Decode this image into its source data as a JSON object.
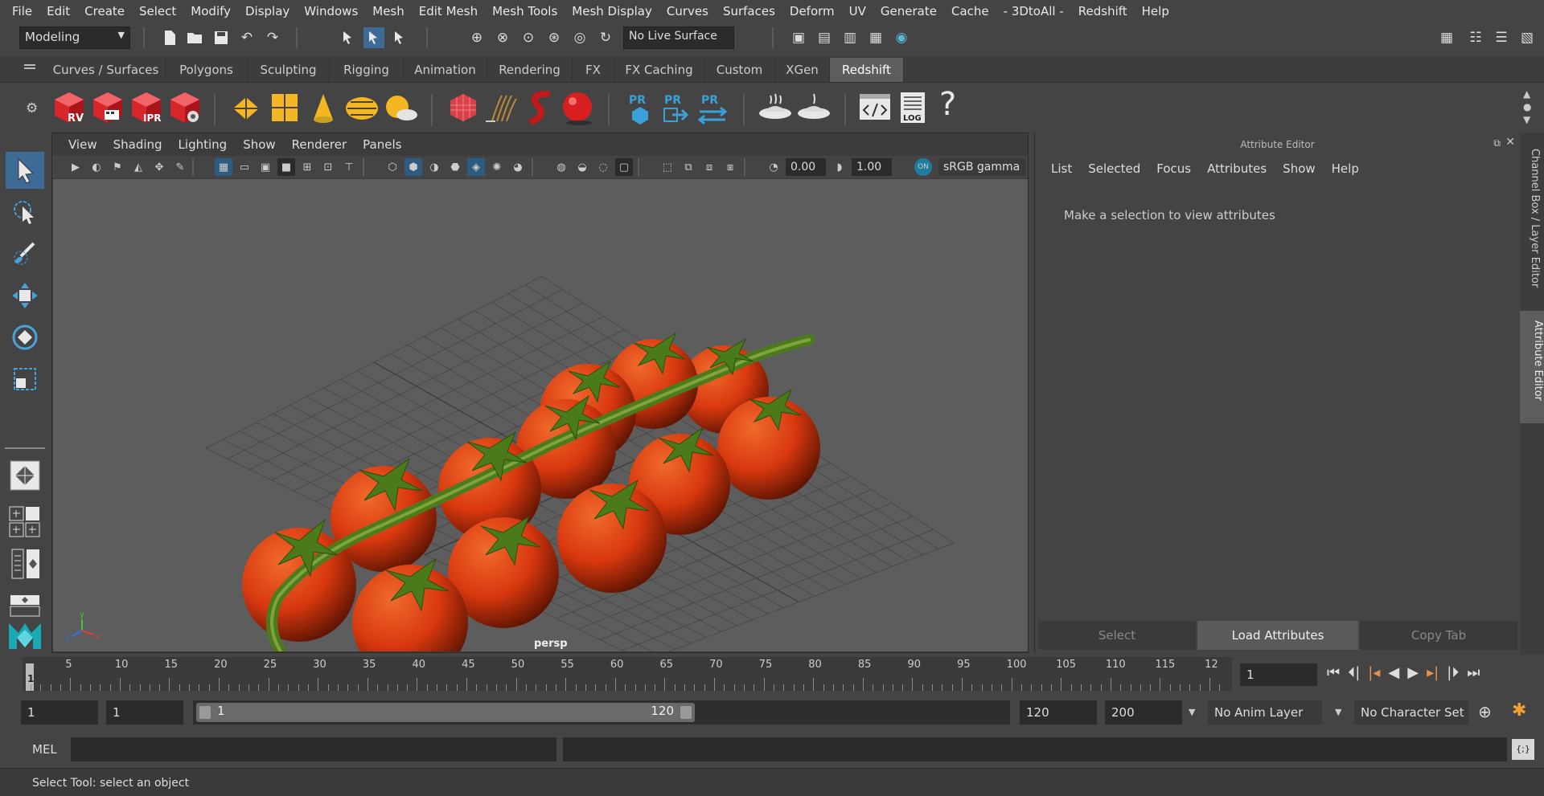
{
  "menubar": {
    "items": [
      "File",
      "Edit",
      "Create",
      "Select",
      "Modify",
      "Display",
      "Windows",
      "Mesh",
      "Edit Mesh",
      "Mesh Tools",
      "Mesh Display",
      "Curves",
      "Surfaces",
      "Deform",
      "UV",
      "Generate",
      "Cache",
      "- 3DtoAll -",
      "Redshift",
      "Help"
    ]
  },
  "statusline": {
    "workspace": "Modeling",
    "live_surface": "No Live Surface"
  },
  "shelf": {
    "tabs": [
      "Curves / Surfaces",
      "Polygons",
      "Sculpting",
      "Rigging",
      "Animation",
      "Rendering",
      "FX",
      "FX Caching",
      "Custom",
      "XGen",
      "Redshift"
    ],
    "active_tab": "Redshift",
    "icon_labels": {
      "rv": "RV",
      "ipr": "IPR",
      "pr": "PR",
      "log": "LOG",
      "help": "?"
    }
  },
  "viewport": {
    "menu": [
      "View",
      "Shading",
      "Lighting",
      "Show",
      "Renderer",
      "Panels"
    ],
    "exposure": "0.00",
    "gamma": "1.00",
    "color_space": "sRGB gamma",
    "camera_label": "persp",
    "axis_labels": {
      "x": "x",
      "y": "y",
      "z": "z"
    }
  },
  "attribute_editor": {
    "title": "Attribute Editor",
    "menu": [
      "List",
      "Selected",
      "Focus",
      "Attributes",
      "Show",
      "Help"
    ],
    "message": "Make a selection to view attributes",
    "buttons": [
      "Select",
      "Load Attributes",
      "Copy Tab"
    ]
  },
  "side_tabs": [
    "Channel Box / Layer Editor",
    "Attribute Editor"
  ],
  "timeslider": {
    "ticks": [
      "5",
      "10",
      "15",
      "20",
      "25",
      "30",
      "35",
      "40",
      "45",
      "50",
      "55",
      "60",
      "65",
      "70",
      "75",
      "80",
      "85",
      "90",
      "95",
      "100",
      "105",
      "110",
      "115",
      "12"
    ],
    "current_frame_marker": "1",
    "current_frame": "1"
  },
  "range": {
    "start": "1",
    "playback_start": "1",
    "slider_start": "1",
    "slider_end": "120",
    "playback_end": "120",
    "end": "200",
    "anim_layer": "No Anim Layer",
    "character_set": "No Character Set"
  },
  "cmdline": {
    "mode": "MEL",
    "bracket": "{;}"
  },
  "helpline": {
    "text": "Select Tool: select an object"
  },
  "colors": {
    "background": "#444444",
    "viewport": "#5d5d5d",
    "tomato": "#d8380e",
    "stem": "#4e7a1e",
    "active_blue": "#3d6b95"
  }
}
